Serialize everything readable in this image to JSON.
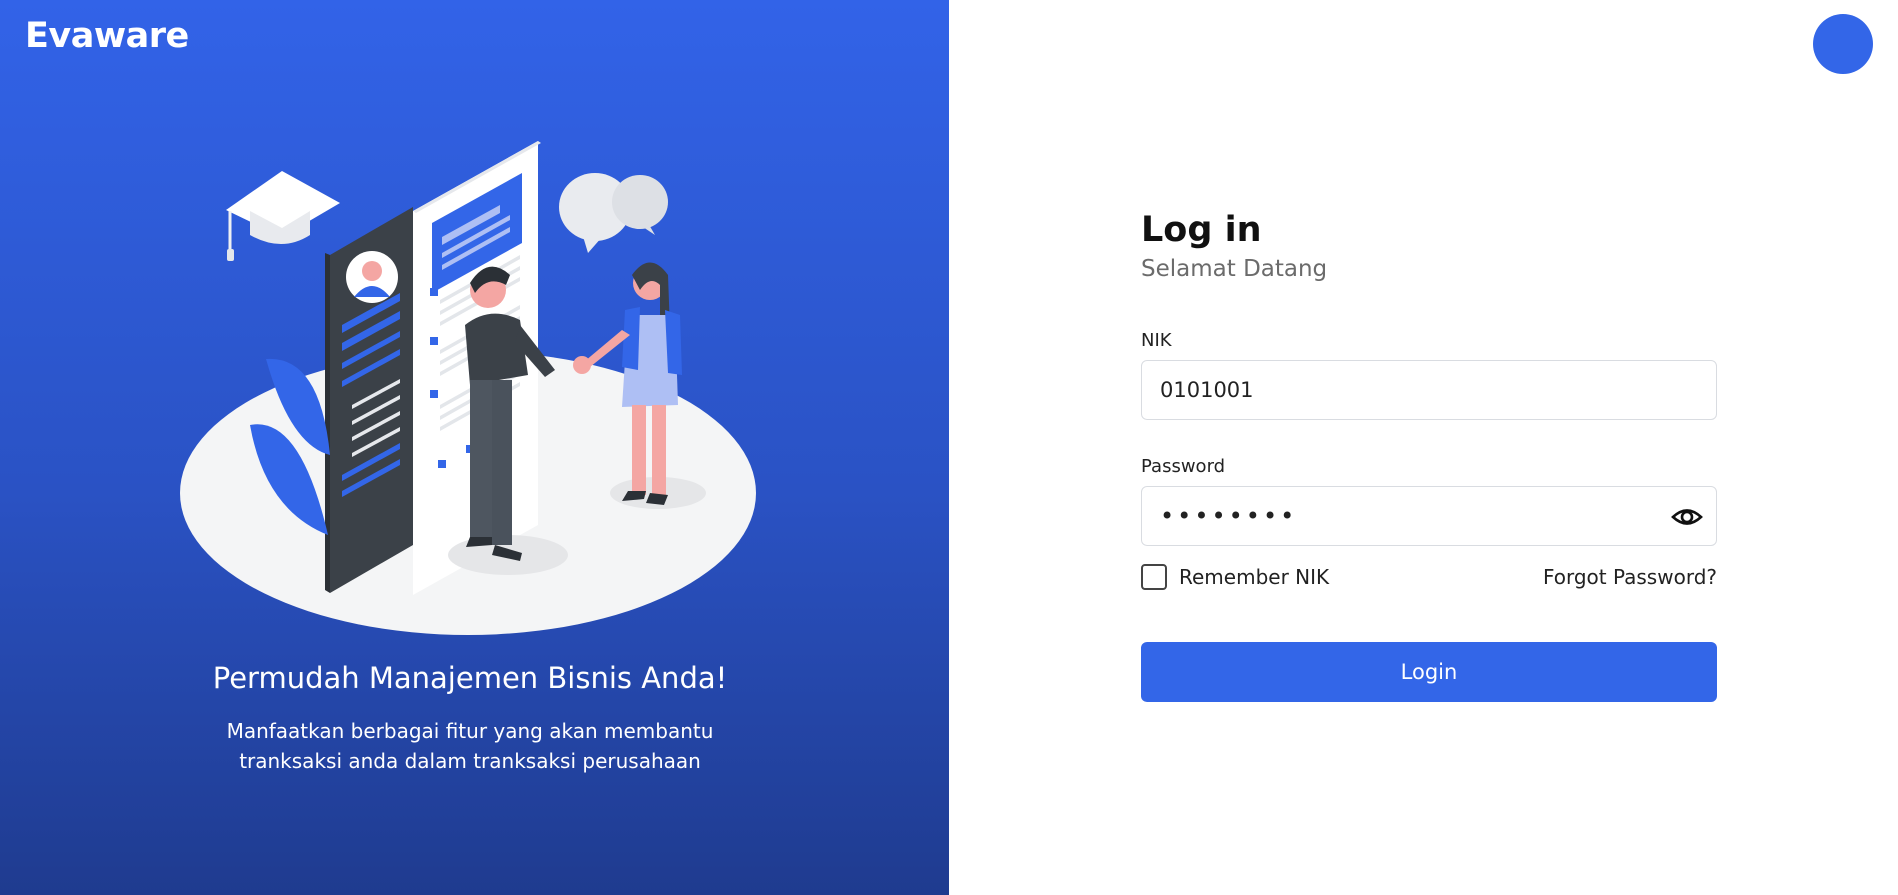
{
  "brand": {
    "name": "Evaware"
  },
  "hero": {
    "heading": "Permudah Manajemen Bisnis Anda!",
    "sub_line1": "Manfaatkan berbagai fitur yang akan membantu",
    "sub_line2": "tranksaksi anda dalam tranksaksi perusahaan",
    "illustration": "business-handshake-illustration"
  },
  "login": {
    "title": "Log in",
    "subtitle": "Selamat Datang",
    "nik_label": "NIK",
    "nik_value": "0101001",
    "password_label": "Password",
    "password_value": "••••••••",
    "password_toggle_icon": "eye-icon",
    "remember_label": "Remember NIK",
    "remember_checked": false,
    "forgot_label": "Forgot Password?",
    "button_label": "Login"
  },
  "colors": {
    "primary": "#3366e8",
    "panel_top": "#3263e8",
    "panel_bottom": "#1f3b8f",
    "text_muted": "#6b6b6b"
  }
}
